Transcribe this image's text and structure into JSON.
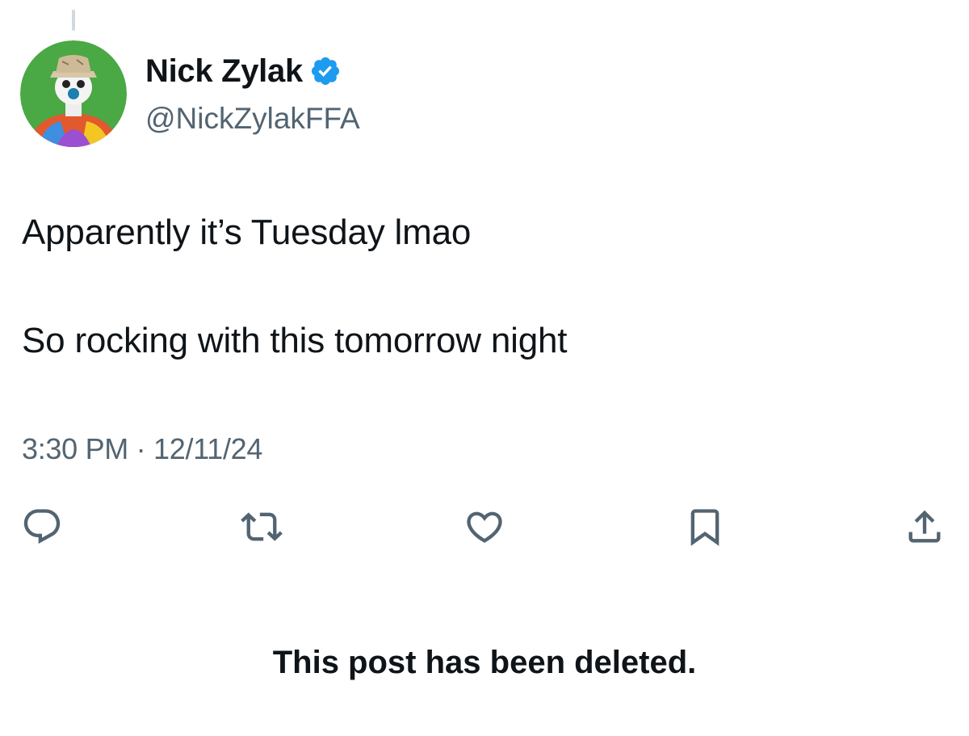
{
  "post": {
    "author": {
      "display_name": "Nick Zylak",
      "handle": "@NickZylakFFA",
      "verified": true,
      "avatar_icon": "cartoon-avatar"
    },
    "text_lines": [
      "Apparently it’s Tuesday lmao",
      "So rocking with this tomorrow night"
    ],
    "timestamp": "3:30 PM · 12/11/24",
    "actions": {
      "reply_icon": "reply-icon",
      "repost_icon": "repost-icon",
      "like_icon": "heart-icon",
      "bookmark_icon": "bookmark-icon",
      "share_icon": "share-icon"
    }
  },
  "status_message": "This post has been deleted.",
  "colors": {
    "text_primary": "#0f1419",
    "text_secondary": "#536471",
    "verified_blue": "#1d9bf0",
    "thread_line": "#cfd9de"
  }
}
